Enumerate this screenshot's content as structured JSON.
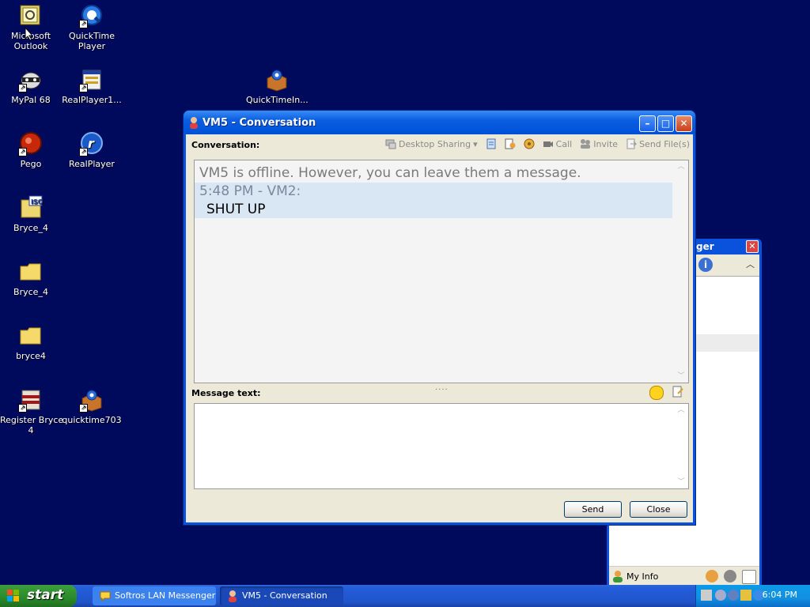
{
  "desktop": {
    "icons": [
      {
        "label": "Microsoft\nOutlook"
      },
      {
        "label": "QuickTime\nPlayer"
      },
      {
        "label": "MyPal 68"
      },
      {
        "label": "RealPlayer1..."
      },
      {
        "label": "QuickTimeIn..."
      },
      {
        "label": "Pego"
      },
      {
        "label": "RealPlayer"
      },
      {
        "label": "Bryce_4"
      },
      {
        "label": "Bryce_4"
      },
      {
        "label": "bryce4"
      },
      {
        "label": "Register Bryce\n4"
      },
      {
        "label": "quicktime703"
      }
    ]
  },
  "conversation": {
    "title": "VM5 - Conversation",
    "conversation_label": "Conversation:",
    "toolbar": {
      "desktop_sharing": "Desktop Sharing",
      "call": "Call",
      "invite": "Invite",
      "send_files": "Send File(s)"
    },
    "offline_notice": "VM5 is offline. However, you can leave them a message.",
    "messages": [
      {
        "header": "5:48 PM - VM2:",
        "text": "SHUT UP"
      }
    ],
    "splitter": "....",
    "message_text_label": "Message text:",
    "input_value": "",
    "send_label": "Send",
    "close_label": "Close"
  },
  "messenger": {
    "title": "ger",
    "my_info": "My Info"
  },
  "taskbar": {
    "start": "start",
    "tasks": [
      {
        "label": "Softros LAN Messenger"
      },
      {
        "label": "VM5 - Conversation"
      }
    ],
    "clock": "6:04 PM"
  }
}
